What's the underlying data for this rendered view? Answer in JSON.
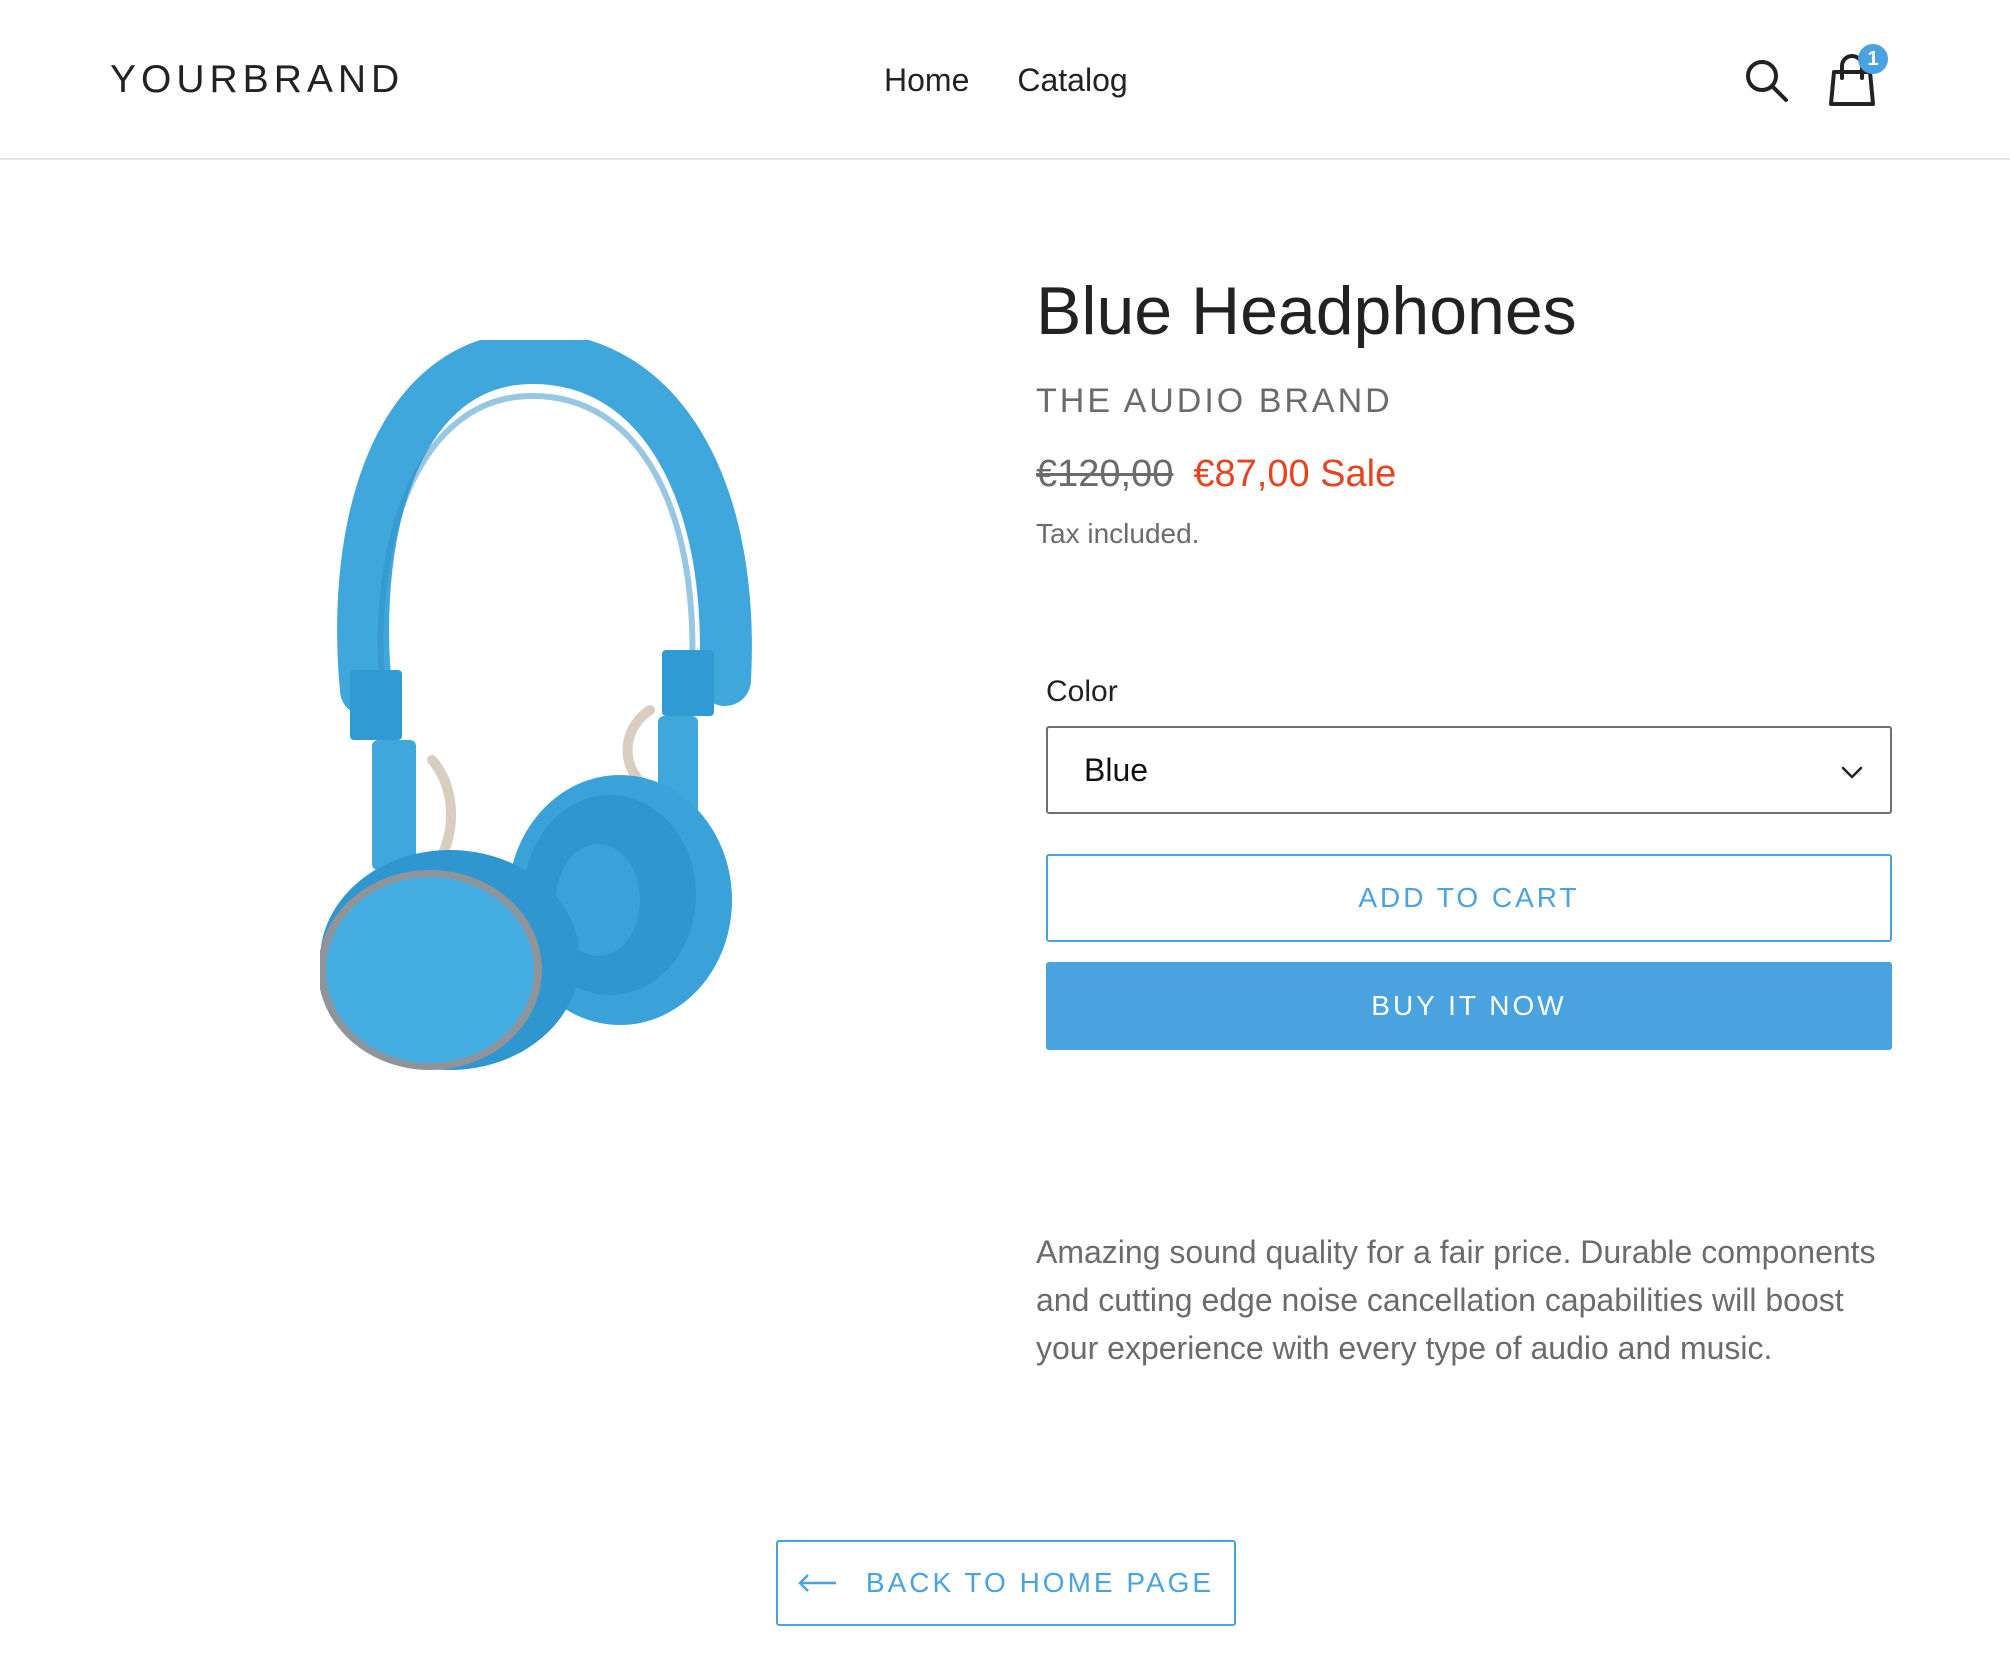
{
  "header": {
    "brand": "YOURBRAND",
    "nav": [
      {
        "label": "Home"
      },
      {
        "label": "Catalog"
      }
    ],
    "search_icon": "search-icon",
    "cart_icon": "cart-icon",
    "cart_count": "1"
  },
  "product": {
    "image_icon": "headphones-image",
    "title": "Blue Headphones",
    "vendor": "THE AUDIO BRAND",
    "price_compare": "€120,00",
    "price_sale": "€87,00 Sale",
    "tax_note": "Tax included.",
    "option": {
      "label": "Color",
      "selected": "Blue"
    },
    "add_to_cart_label": "ADD TO CART",
    "buy_now_label": "BUY IT NOW",
    "description": "Amazing sound quality for a fair price. Durable components and cutting edge noise cancellation capabilities will boost your experience with every type of audio and music."
  },
  "footer": {
    "back_label": "BACK TO HOME PAGE"
  },
  "colors": {
    "accent": "#4aa3df",
    "sale": "#e4451f",
    "text": "#222222",
    "muted": "#6b6b6b"
  }
}
